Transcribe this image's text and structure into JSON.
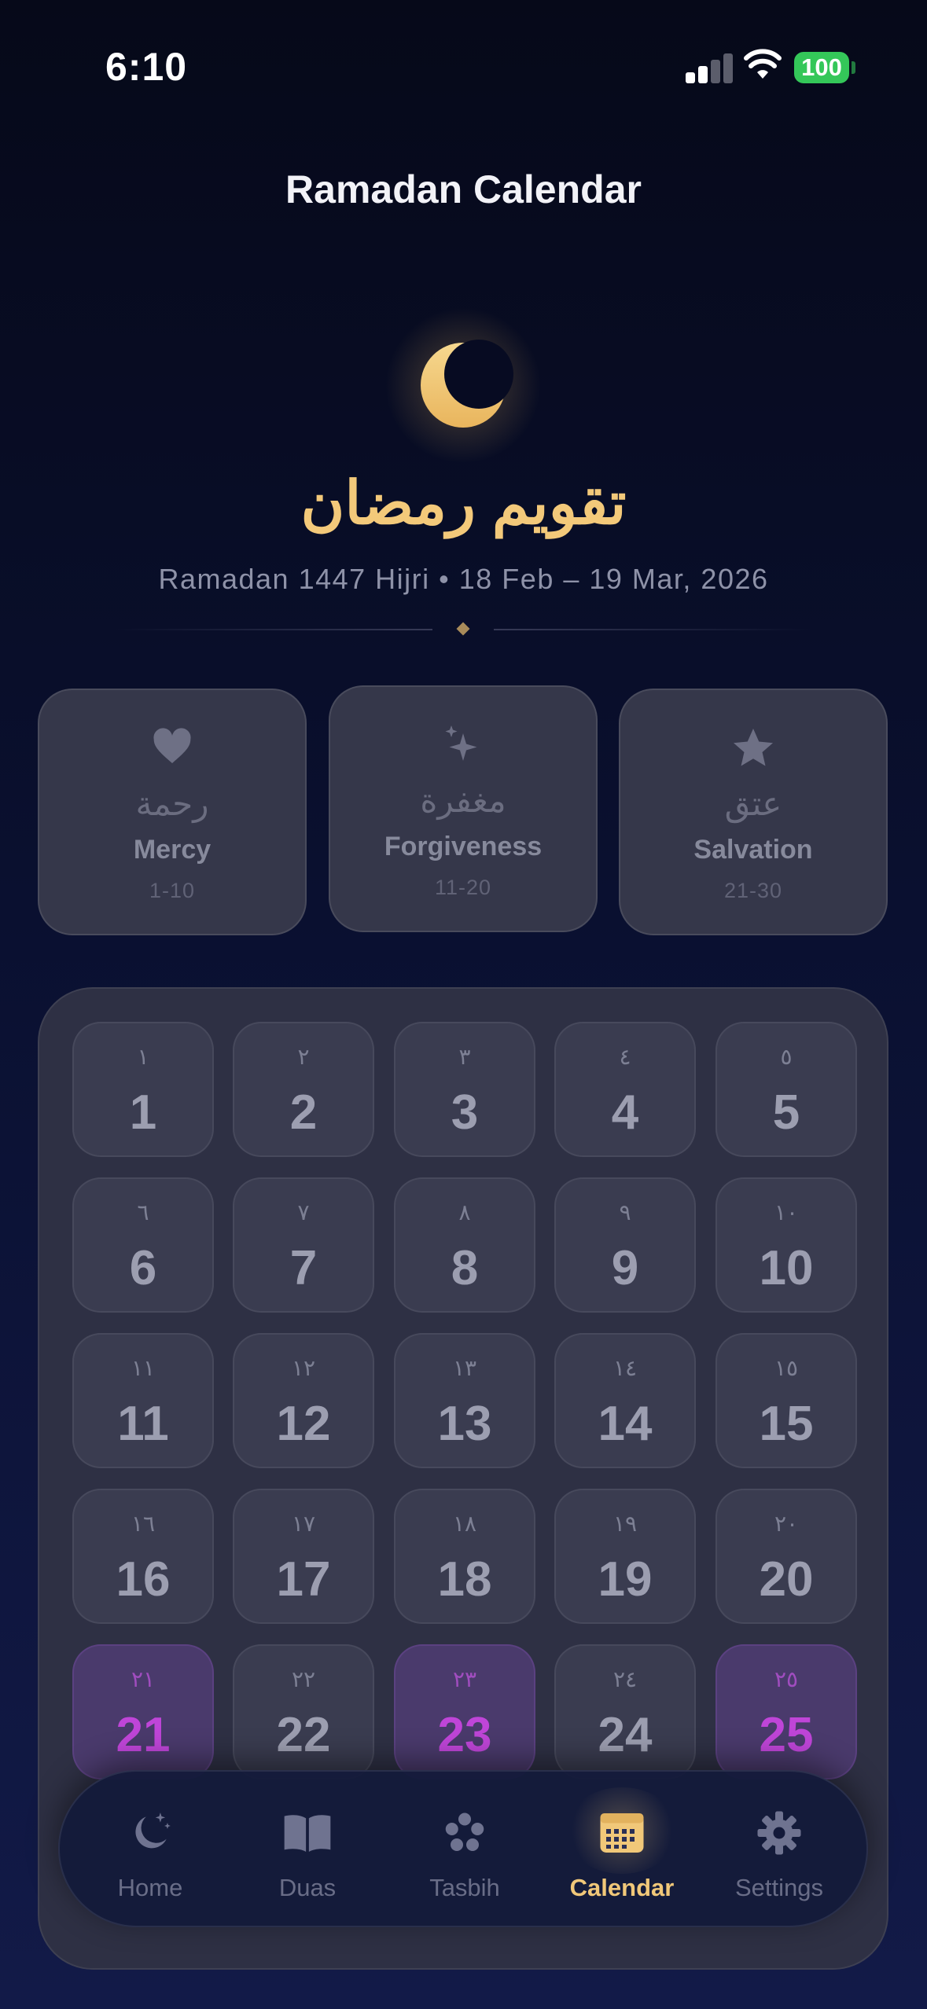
{
  "status": {
    "time": "6:10",
    "battery": "100"
  },
  "header": {
    "title": "Ramadan Calendar",
    "arabic_title": "تقويم رمضان",
    "subtitle": "Ramadan 1447 Hijri • 18 Feb – 19 Mar, 2026"
  },
  "phases": [
    {
      "arabic": "رحمة",
      "name": "Mercy",
      "range": "1-10",
      "icon": "heart-icon"
    },
    {
      "arabic": "مغفرة",
      "name": "Forgiveness",
      "range": "11-20",
      "icon": "sparkles-icon"
    },
    {
      "arabic": "عتق",
      "name": "Salvation",
      "range": "21-30",
      "icon": "star-icon"
    }
  ],
  "days": [
    {
      "ar": "١",
      "num": "1"
    },
    {
      "ar": "٢",
      "num": "2"
    },
    {
      "ar": "٣",
      "num": "3"
    },
    {
      "ar": "٤",
      "num": "4"
    },
    {
      "ar": "٥",
      "num": "5"
    },
    {
      "ar": "٦",
      "num": "6"
    },
    {
      "ar": "٧",
      "num": "7"
    },
    {
      "ar": "٨",
      "num": "8"
    },
    {
      "ar": "٩",
      "num": "9"
    },
    {
      "ar": "١٠",
      "num": "10"
    },
    {
      "ar": "١١",
      "num": "11"
    },
    {
      "ar": "١٢",
      "num": "12"
    },
    {
      "ar": "١٣",
      "num": "13"
    },
    {
      "ar": "١٤",
      "num": "14"
    },
    {
      "ar": "١٥",
      "num": "15"
    },
    {
      "ar": "١٦",
      "num": "16"
    },
    {
      "ar": "١٧",
      "num": "17"
    },
    {
      "ar": "١٨",
      "num": "18"
    },
    {
      "ar": "١٩",
      "num": "19"
    },
    {
      "ar": "٢٠",
      "num": "20"
    },
    {
      "ar": "٢١",
      "num": "21",
      "odd_night": true
    },
    {
      "ar": "٢٢",
      "num": "22"
    },
    {
      "ar": "٢٣",
      "num": "23",
      "odd_night": true
    },
    {
      "ar": "٢٤",
      "num": "24"
    },
    {
      "ar": "٢٥",
      "num": "25",
      "odd_night": true
    }
  ],
  "tabs": [
    {
      "label": "Home",
      "icon": "moon-stars-icon"
    },
    {
      "label": "Duas",
      "icon": "book-icon"
    },
    {
      "label": "Tasbih",
      "icon": "beads-icon"
    },
    {
      "label": "Calendar",
      "icon": "calendar-icon",
      "active": true
    },
    {
      "label": "Settings",
      "icon": "gear-icon"
    }
  ],
  "colors": {
    "accent_gold": "#f3c97a",
    "odd_night_purple": "#bf45d8",
    "battery_green": "#34c759"
  }
}
